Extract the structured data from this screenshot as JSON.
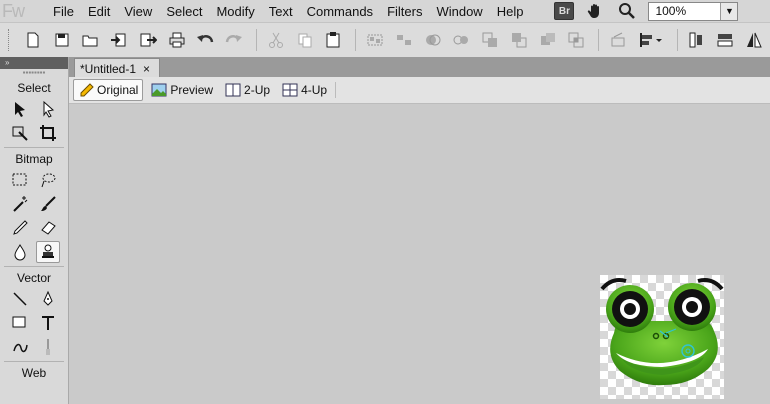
{
  "app": {
    "logo": "Fw"
  },
  "menu": [
    "File",
    "Edit",
    "View",
    "Select",
    "Modify",
    "Text",
    "Commands",
    "Filters",
    "Window",
    "Help"
  ],
  "menubar_right": {
    "bridge_label": "Br",
    "zoom_value": "100%"
  },
  "toolbar": {
    "icons": [
      "new-file-icon",
      "save-icon",
      "open-folder-icon",
      "import-icon",
      "export-icon",
      "print-icon",
      "undo-icon",
      "redo-icon",
      "cut-icon",
      "copy-icon",
      "paste-icon",
      "group-icon",
      "ungroup-icon",
      "join-icon",
      "split-icon",
      "bring-forward-icon",
      "send-backward-icon",
      "union-icon",
      "intersect-icon",
      "rotate-icon",
      "align-icon",
      "flip-vertical-icon",
      "flip-horizontal-icon",
      "flip-icon"
    ]
  },
  "tools": {
    "header": "»",
    "sections": {
      "select": "Select",
      "bitmap": "Bitmap",
      "vector": "Vector",
      "web": "Web"
    }
  },
  "document": {
    "tab_title": "*Untitled-1",
    "close_glyph": "×"
  },
  "view_modes": {
    "original": "Original",
    "preview": "Preview",
    "two_up": "2-Up",
    "four_up": "4-Up",
    "active": "Original"
  },
  "colors": {
    "frog_green": "#4aa51a",
    "frog_dark": "#2f7d0c",
    "eye_black": "#111111",
    "selection_cyan": "#2ec4d6"
  }
}
